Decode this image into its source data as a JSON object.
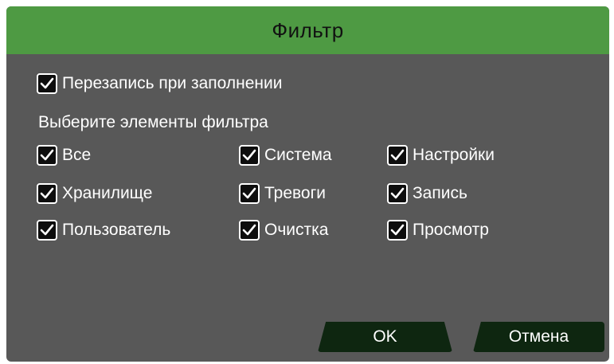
{
  "dialog": {
    "title": "Фильтр",
    "overwrite": {
      "label": "Перезапись при заполнении",
      "checked": true
    },
    "section_label": "Выберите элементы фильтра",
    "filters": [
      {
        "id": "all",
        "label": "Все",
        "checked": true
      },
      {
        "id": "system",
        "label": "Система",
        "checked": true
      },
      {
        "id": "settings",
        "label": "Настройки",
        "checked": true
      },
      {
        "id": "storage",
        "label": "Хранилище",
        "checked": true
      },
      {
        "id": "alarms",
        "label": "Тревоги",
        "checked": true
      },
      {
        "id": "record",
        "label": "Запись",
        "checked": true
      },
      {
        "id": "user",
        "label": "Пользователь",
        "checked": true
      },
      {
        "id": "clear",
        "label": "Очистка",
        "checked": true
      },
      {
        "id": "playback",
        "label": "Просмотр",
        "checked": true
      }
    ],
    "buttons": {
      "ok": "OK",
      "cancel": "Отмена"
    }
  },
  "colors": {
    "titlebar": "#4e9a43",
    "panel": "#585858",
    "button": "#0e2610"
  },
  "icons": {
    "checkbox": "check-icon"
  }
}
